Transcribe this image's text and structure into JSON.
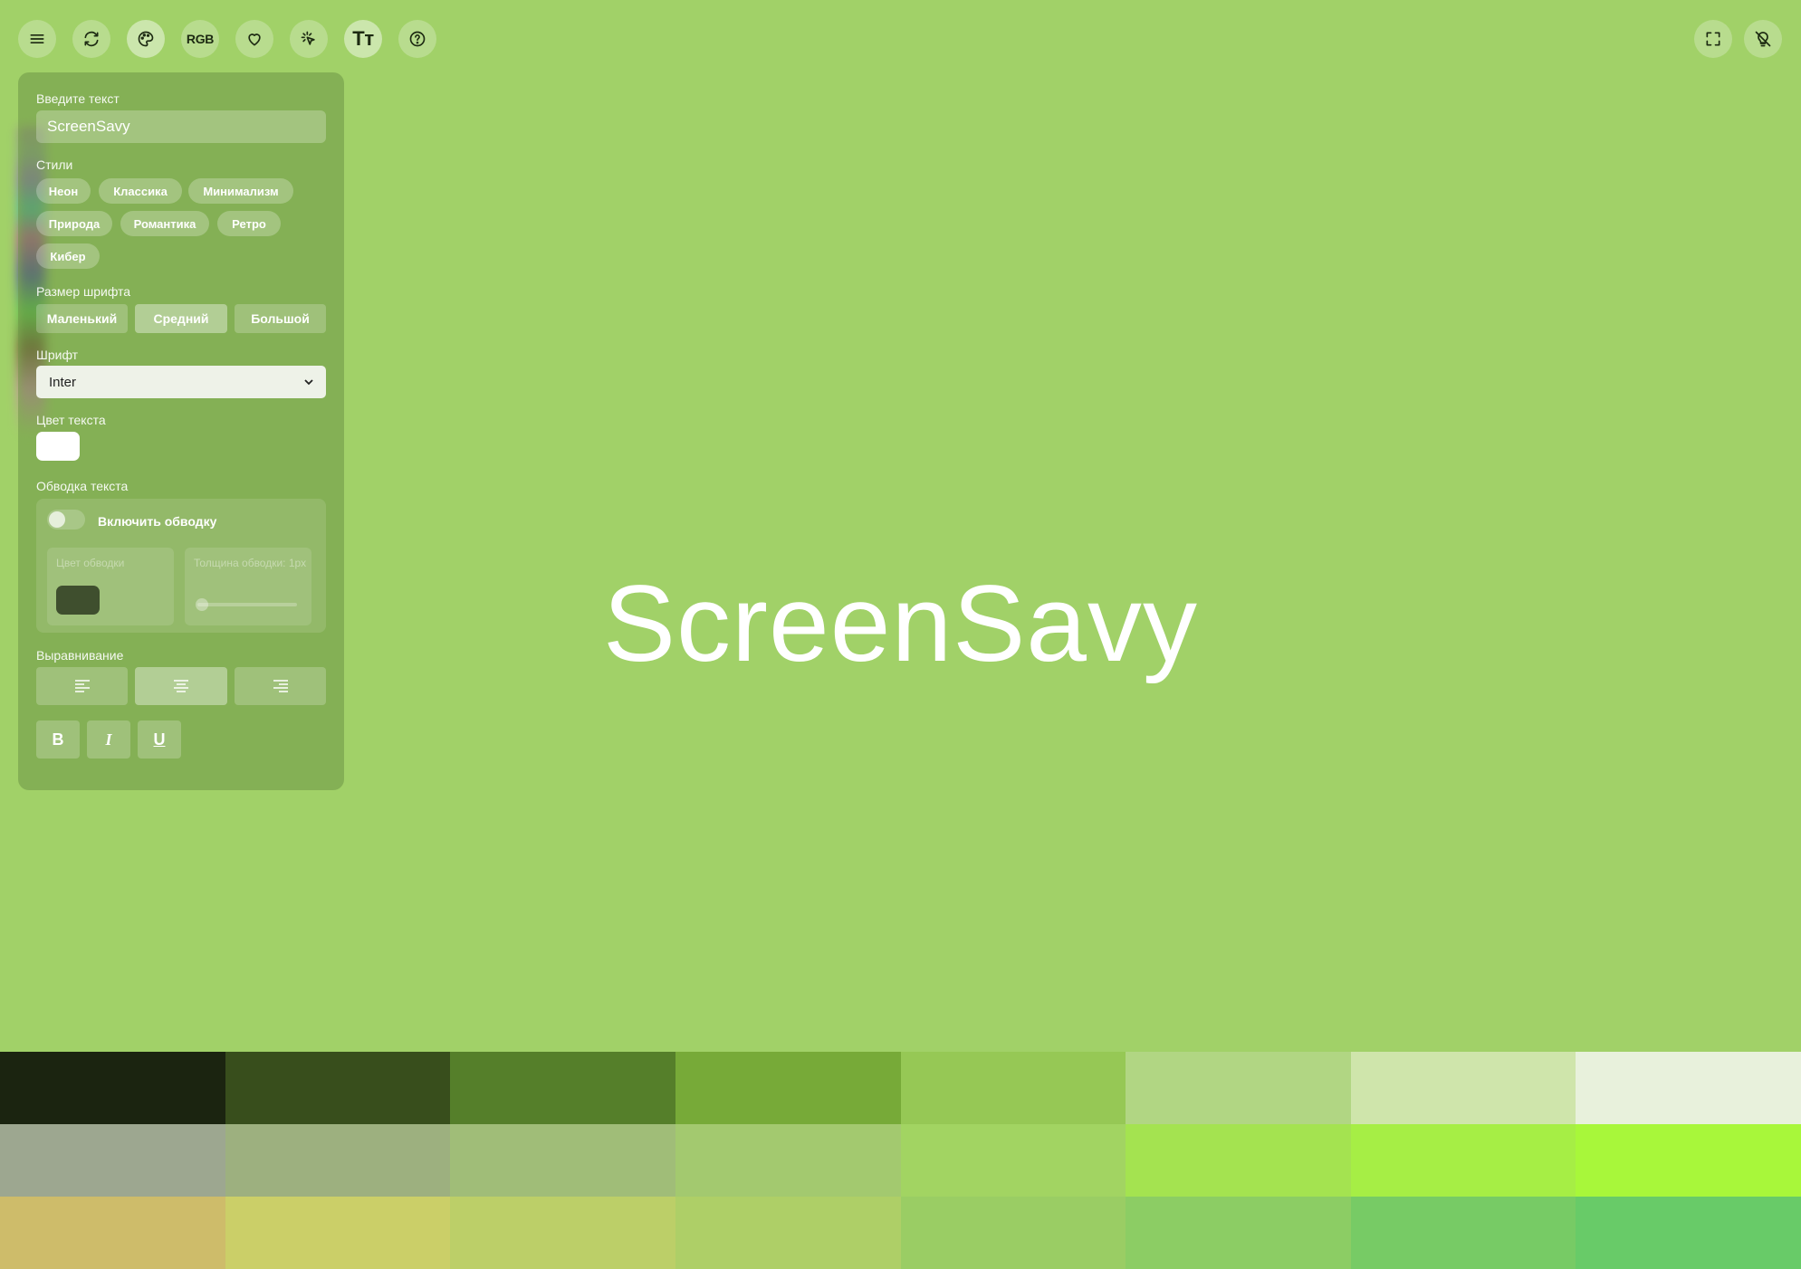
{
  "toolbar": {
    "rgb_label": "RGB",
    "tt_label": "Tт"
  },
  "panel": {
    "text_label": "Введите текст",
    "text_value": "ScreenSavy",
    "styles_label": "Стили",
    "styles": [
      "Неон",
      "Классика",
      "Минимализм",
      "Природа",
      "Романтика",
      "Ретро",
      "Кибер"
    ],
    "font_size_label": "Размер шрифта",
    "font_sizes": [
      "Маленький",
      "Средний",
      "Большой"
    ],
    "font_size_selected": "Средний",
    "font_label": "Шрифт",
    "font_value": "Inter",
    "text_color_label": "Цвет текста",
    "text_color": "#ffffff",
    "stroke_label": "Обводка текста",
    "stroke_toggle_label": "Включить обводку",
    "stroke_enabled": false,
    "stroke_color_label": "Цвет обводки",
    "stroke_color": "#3f4f2e",
    "stroke_width_label": "Толщина обводки: 1px",
    "align_label": "Выравнивание",
    "align_selected": "center",
    "bold_label": "B",
    "italic_label": "I",
    "underline_label": "U"
  },
  "canvas": {
    "text": "ScreenSavy",
    "background": "#a1d168"
  },
  "palette": [
    "#1b2410",
    "#384e1c",
    "#557f2a",
    "#77aa38",
    "#96c855",
    "#b1d683",
    "#cfe5ab",
    "#e8f1dc",
    "#9da790",
    "#9db07f",
    "#a0bd78",
    "#a3c96f",
    "#a2d462",
    "#a4e350",
    "#a6ee45",
    "#a8f73a",
    "#cebc6a",
    "#cbcf68",
    "#bccf68",
    "#aecf67",
    "#9acd64",
    "#8ccd64",
    "#77cb65",
    "#68cb68"
  ]
}
